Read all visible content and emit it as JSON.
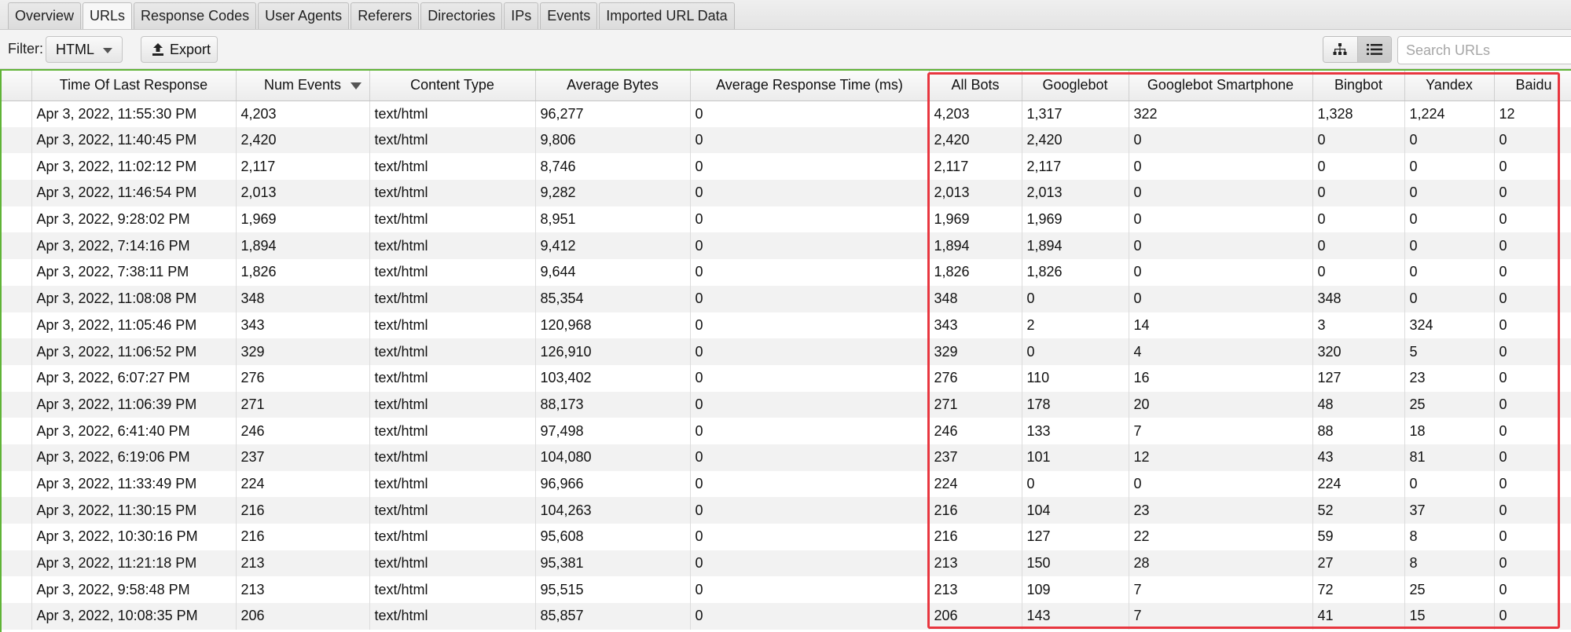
{
  "tabs": [
    "Overview",
    "URLs",
    "Response Codes",
    "User Agents",
    "Referers",
    "Directories",
    "IPs",
    "Events",
    "Imported URL Data"
  ],
  "active_tab": 1,
  "toolbar": {
    "filter_label": "Filter:",
    "filter_value": "HTML",
    "export_label": "Export",
    "search_placeholder": "Search URLs"
  },
  "table": {
    "columns": [
      "Time Of Last Response",
      "Num Events",
      "Content Type",
      "Average Bytes",
      "Average Response Time (ms)",
      "All Bots",
      "Googlebot",
      "Googlebot Smartphone",
      "Bingbot",
      "Yandex",
      "Baidu"
    ],
    "sorted_column": "Num Events",
    "rows": [
      [
        "Apr 3, 2022, 11:55:30 PM",
        "4,203",
        "text/html",
        "96,277",
        "0",
        "4,203",
        "1,317",
        "322",
        "1,328",
        "1,224",
        "12"
      ],
      [
        "Apr 3, 2022, 11:40:45 PM",
        "2,420",
        "text/html",
        "9,806",
        "0",
        "2,420",
        "2,420",
        "0",
        "0",
        "0",
        "0"
      ],
      [
        "Apr 3, 2022, 11:02:12 PM",
        "2,117",
        "text/html",
        "8,746",
        "0",
        "2,117",
        "2,117",
        "0",
        "0",
        "0",
        "0"
      ],
      [
        "Apr 3, 2022, 11:46:54 PM",
        "2,013",
        "text/html",
        "9,282",
        "0",
        "2,013",
        "2,013",
        "0",
        "0",
        "0",
        "0"
      ],
      [
        "Apr 3, 2022, 9:28:02 PM",
        "1,969",
        "text/html",
        "8,951",
        "0",
        "1,969",
        "1,969",
        "0",
        "0",
        "0",
        "0"
      ],
      [
        "Apr 3, 2022, 7:14:16 PM",
        "1,894",
        "text/html",
        "9,412",
        "0",
        "1,894",
        "1,894",
        "0",
        "0",
        "0",
        "0"
      ],
      [
        "Apr 3, 2022, 7:38:11 PM",
        "1,826",
        "text/html",
        "9,644",
        "0",
        "1,826",
        "1,826",
        "0",
        "0",
        "0",
        "0"
      ],
      [
        "Apr 3, 2022, 11:08:08 PM",
        "348",
        "text/html",
        "85,354",
        "0",
        "348",
        "0",
        "0",
        "348",
        "0",
        "0"
      ],
      [
        "Apr 3, 2022, 11:05:46 PM",
        "343",
        "text/html",
        "120,968",
        "0",
        "343",
        "2",
        "14",
        "3",
        "324",
        "0"
      ],
      [
        "Apr 3, 2022, 11:06:52 PM",
        "329",
        "text/html",
        "126,910",
        "0",
        "329",
        "0",
        "4",
        "320",
        "5",
        "0"
      ],
      [
        "Apr 3, 2022, 6:07:27 PM",
        "276",
        "text/html",
        "103,402",
        "0",
        "276",
        "110",
        "16",
        "127",
        "23",
        "0"
      ],
      [
        "Apr 3, 2022, 11:06:39 PM",
        "271",
        "text/html",
        "88,173",
        "0",
        "271",
        "178",
        "20",
        "48",
        "25",
        "0"
      ],
      [
        "Apr 3, 2022, 6:41:40 PM",
        "246",
        "text/html",
        "97,498",
        "0",
        "246",
        "133",
        "7",
        "88",
        "18",
        "0"
      ],
      [
        "Apr 3, 2022, 6:19:06 PM",
        "237",
        "text/html",
        "104,080",
        "0",
        "237",
        "101",
        "12",
        "43",
        "81",
        "0"
      ],
      [
        "Apr 3, 2022, 11:33:49 PM",
        "224",
        "text/html",
        "96,966",
        "0",
        "224",
        "0",
        "0",
        "224",
        "0",
        "0"
      ],
      [
        "Apr 3, 2022, 11:30:15 PM",
        "216",
        "text/html",
        "104,263",
        "0",
        "216",
        "104",
        "23",
        "52",
        "37",
        "0"
      ],
      [
        "Apr 3, 2022, 10:30:16 PM",
        "216",
        "text/html",
        "95,608",
        "0",
        "216",
        "127",
        "22",
        "59",
        "8",
        "0"
      ],
      [
        "Apr 3, 2022, 11:21:18 PM",
        "213",
        "text/html",
        "95,381",
        "0",
        "213",
        "150",
        "28",
        "27",
        "8",
        "0"
      ],
      [
        "Apr 3, 2022, 9:58:48 PM",
        "213",
        "text/html",
        "95,515",
        "0",
        "213",
        "109",
        "7",
        "72",
        "25",
        "0"
      ],
      [
        "Apr 3, 2022, 10:08:35 PM",
        "206",
        "text/html",
        "85,857",
        "0",
        "206",
        "143",
        "7",
        "41",
        "15",
        "0"
      ]
    ]
  },
  "colors": {
    "highlight_border": "#e8363f",
    "grid_focus_border": "#5fb336"
  }
}
